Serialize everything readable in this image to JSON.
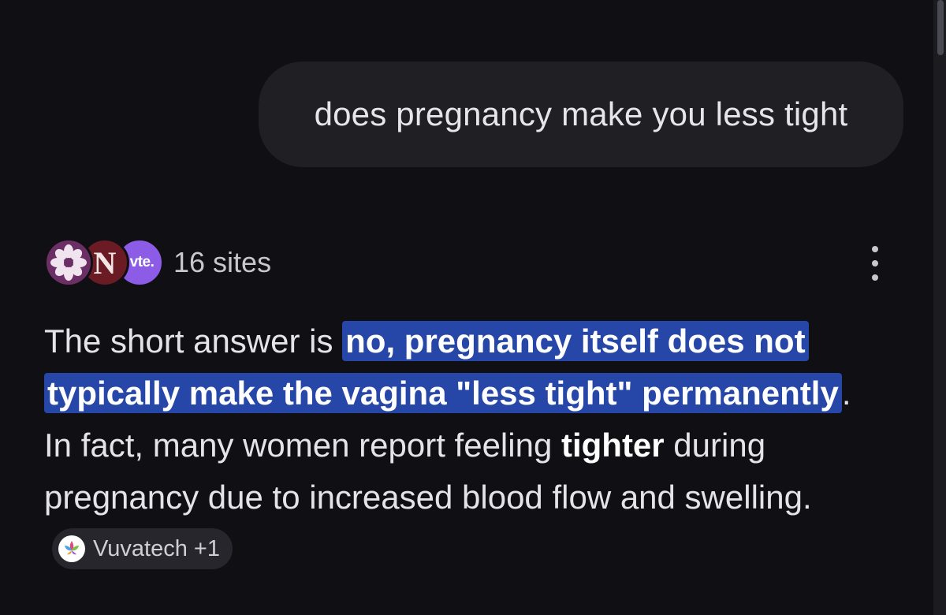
{
  "query": {
    "text": "does pregnancy make you less tight"
  },
  "sources": {
    "count_label": "16 sites",
    "favicons": [
      {
        "name": "flower-logo",
        "color": "#6b2f66"
      },
      {
        "name": "n-logo",
        "letter": "N",
        "color": "#6a1b23"
      },
      {
        "name": "vte-logo",
        "letter": "vte.",
        "color": "#8c5ce6"
      }
    ]
  },
  "answer": {
    "intro": "The short answer is ",
    "highlight_1": "no, pregnancy itself does not typically make the vagina \"less tight\" permanently",
    "after_highlight": ". In fact, many women report feeling ",
    "bold_word": "tighter",
    "rest": " during pregnancy due to increased blood flow and swelling.",
    "citation_label": "Vuvatech +1"
  },
  "colors": {
    "background": "#0f0f14",
    "bubble": "#1f1f24",
    "highlight": "#2747a8",
    "chip": "#26262c"
  },
  "icons": {
    "more": "more-vertical-icon",
    "citation": "vuvatech-logo-icon"
  }
}
